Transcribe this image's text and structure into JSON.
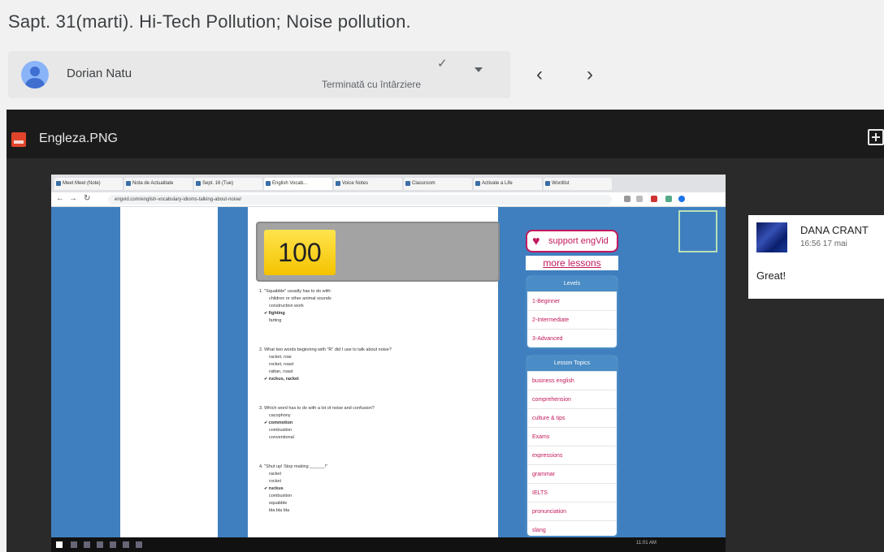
{
  "assignment_title": "Sapt. 31(marti). Hi-Tech Pollution; Noise pollution.",
  "student": {
    "name": "Dorian Natu",
    "status": "Terminată cu întârziere",
    "status_icon": "checkmark-icon"
  },
  "viewer": {
    "file_name": "Engleza.PNG",
    "file_icon": "image-file-icon"
  },
  "screenshot": {
    "browser_tabs": [
      "Meet Meet (Note)",
      "Nota de Actualitate",
      "Sept. 16 (Tue)",
      "English Vocab...",
      "Voice Notes",
      "Classroom",
      "Activate a Life",
      "Wordlist"
    ],
    "url": "engvid.com/english-vocabulary-idioms-talking-about-noise/",
    "score": "100",
    "questions": [
      {
        "text": "1. \"Squabble\" usually has to do with:",
        "options": [
          "children or other animal sounds",
          "construction work",
          "fighting",
          "farting"
        ],
        "correct": 2
      },
      {
        "text": "2. What two words beginning with \"R\" did I use to talk about noise?",
        "options": [
          "racket, roar",
          "rocket, roast",
          "rattan, roast",
          "ruckus, racket"
        ],
        "correct": 3
      },
      {
        "text": "3. Which word has to do with a lot of noise and confusion?",
        "options": [
          "cacophony",
          "commotion",
          "combustion",
          "conventional"
        ],
        "correct": 1
      },
      {
        "text": "4. \"Shut up! Stop making ______!\"",
        "options": [
          "racket",
          "rocket",
          "ruckus",
          "combustion",
          "squabble",
          "bla bla bla"
        ],
        "correct": 2
      }
    ],
    "support_label": "support engVid",
    "more_lessons": "more lessons",
    "levels_header": "Levels",
    "levels": [
      "1-Beginner",
      "2-Intermediate",
      "3-Advanced"
    ],
    "topics_header": "Lesson Topics",
    "topics": [
      "business english",
      "comprehension",
      "culture & tips",
      "Exams",
      "expressions",
      "grammar",
      "IELTS",
      "pronunciation",
      "slang"
    ],
    "clock": "11:01 AM"
  },
  "comment": {
    "author": "DANA CRANT",
    "time": "16:56 17 mai",
    "text": "Great!"
  }
}
